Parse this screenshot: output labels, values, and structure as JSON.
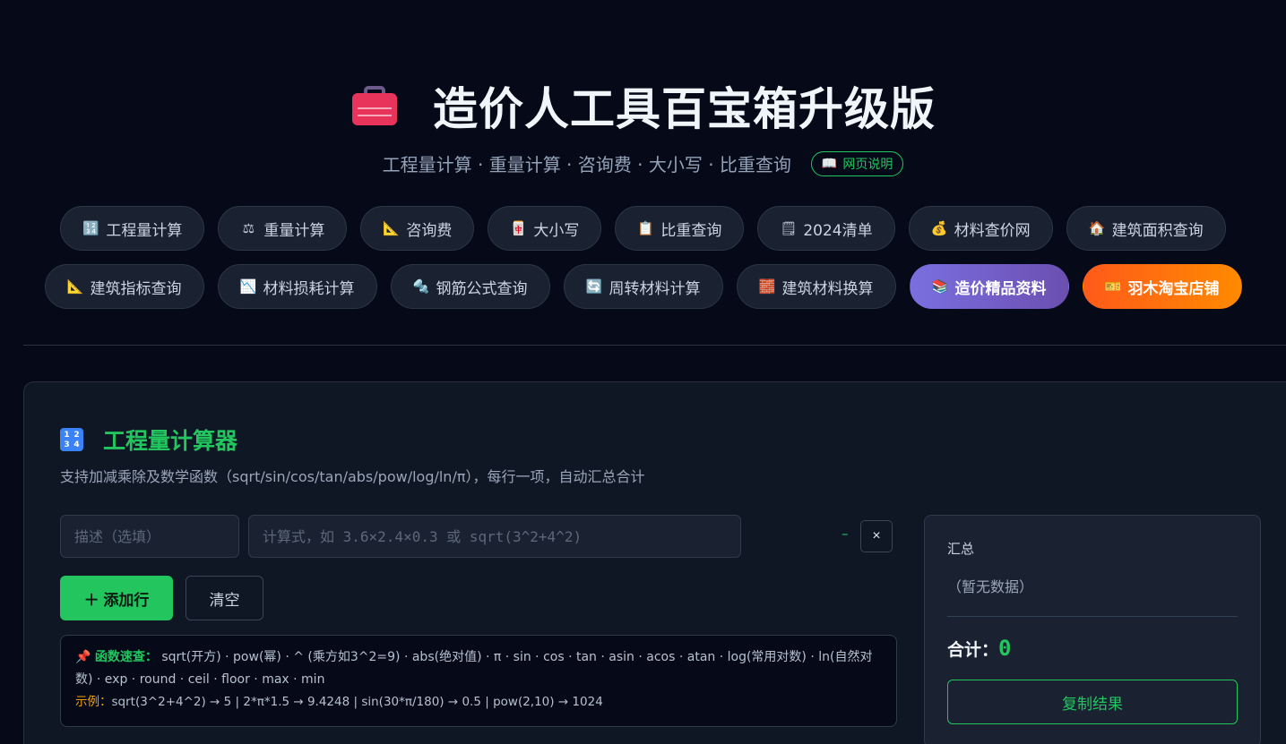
{
  "header": {
    "icon": "toolbox-icon",
    "title": "造价人工具百宝箱升级版",
    "subtitle": "工程量计算 · 重量计算 · 咨询费 · 大小写 · 比重查询",
    "help_icon": "book-icon",
    "help_label": "网页说明"
  },
  "nav": {
    "row1": [
      {
        "icon": "🔢",
        "icon_name": "numbers-icon",
        "label": "工程量计算"
      },
      {
        "icon": "⚖",
        "icon_name": "scale-icon",
        "label": "重量计算"
      },
      {
        "icon": "📐",
        "icon_name": "triangle-ruler-icon",
        "label": "咨询费"
      },
      {
        "icon": "🀄",
        "icon_name": "mahjong-icon",
        "label": "大小写"
      },
      {
        "icon": "📋",
        "icon_name": "clipboard-icon",
        "label": "比重查询"
      },
      {
        "icon": "🗒",
        "icon_name": "notepad-icon",
        "label": "2024清单"
      },
      {
        "icon": "💰",
        "icon_name": "money-bag-icon",
        "label": "材料查价网"
      },
      {
        "icon": "🏠",
        "icon_name": "house-icon",
        "label": "建筑面积查询"
      }
    ],
    "row2": [
      {
        "icon": "📐",
        "icon_name": "triangle-ruler-icon",
        "label": "建筑指标查询"
      },
      {
        "icon": "📉",
        "icon_name": "chart-down-icon",
        "label": "材料损耗计算"
      },
      {
        "icon": "🔩",
        "icon_name": "bolt-icon",
        "label": "钢筋公式查询"
      },
      {
        "icon": "🔄",
        "icon_name": "cycle-icon",
        "label": "周转材料计算"
      },
      {
        "icon": "🧱",
        "icon_name": "brick-icon",
        "label": "建筑材料换算"
      },
      {
        "icon": "📚",
        "icon_name": "books-icon",
        "label": "造价精品资料",
        "style": "purple"
      },
      {
        "icon": "🎫",
        "icon_name": "ticket-icon",
        "label": "羽木淘宝店铺",
        "style": "orange"
      }
    ]
  },
  "calculator": {
    "title": "工程量计算器",
    "description": "支持加减乘除及数学函数（sqrt/sin/cos/tan/abs/pow/log/ln/π），每行一项，自动汇总合计",
    "desc_placeholder": "描述（选填）",
    "expr_placeholder": "计算式，如 3.6×2.4×0.3 或 sqrt(3^2+4^2)",
    "row_result": "–",
    "delete_label": "×",
    "add_label": "＋ 添加行",
    "clear_label": "清空",
    "tips": {
      "label": "函数速查：",
      "functions": "sqrt(开方) · pow(幂) · ^ (乘方如3^2=9) · abs(绝对值) · π · sin · cos · tan · asin · acos · atan · log(常用对数) · ln(自然对数) · exp · round · ceil · floor · max · min",
      "example_label": "示例：",
      "examples": "sqrt(3^2+4^2) → 5  |  2*π*1.5 → 9.4248  |  sin(30*π/180) → 0.5  |  pow(2,10) → 1024"
    }
  },
  "summary": {
    "title": "汇总",
    "empty": "（暂无数据）",
    "total_label": "合计：",
    "total_value": "0",
    "copy_label": "复制结果"
  },
  "colors": {
    "background": "#060a18",
    "accent_green": "#22c55e",
    "pill_bg": "#1a2232",
    "purple": "#7a6fe0",
    "orange": "#ff6a10"
  }
}
